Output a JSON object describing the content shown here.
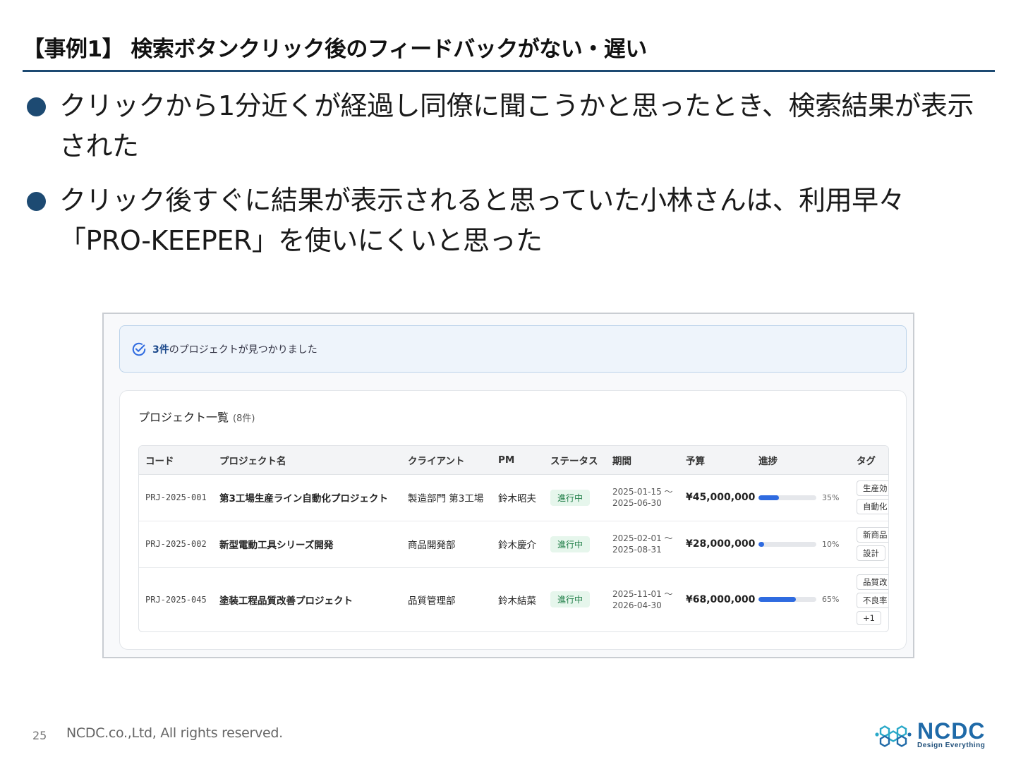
{
  "slide": {
    "title": "【事例1】 検索ボタンクリック後のフィードバックがない・遅い",
    "bullets": [
      "クリックから1分近くが経過し同僚に聞こうかと思ったとき、検索結果が表示された",
      "クリック後すぐに結果が表示されると思っていた小林さんは、利用早々「PRO-KEEPER」を使いにくいと思った"
    ]
  },
  "screenshot": {
    "banner": {
      "count": "3件",
      "text": "のプロジェクトが見つかりました"
    },
    "list": {
      "title": "プロジェクト一覧",
      "count": "(8件)",
      "columns": [
        "コード",
        "プロジェクト名",
        "クライアント",
        "PM",
        "ステータス",
        "期間",
        "予算",
        "進捗",
        "タグ"
      ],
      "rows": [
        {
          "code": "PRJ-2025-001",
          "name": "第3工場生産ライン自動化プロジェクト",
          "client": "製造部門 第3工場",
          "pm": "鈴木昭夫",
          "status": "進行中",
          "period_start": "2025-01-15 〜",
          "period_end": "2025-06-30",
          "budget": "¥45,000,000",
          "progress": 35,
          "progress_label": "35%",
          "tags": [
            "生産効",
            "自動化"
          ]
        },
        {
          "code": "PRJ-2025-002",
          "name": "新型電動工具シリーズ開発",
          "client": "商品開発部",
          "pm": "鈴木慶介",
          "status": "進行中",
          "period_start": "2025-02-01 〜",
          "period_end": "2025-08-31",
          "budget": "¥28,000,000",
          "progress": 10,
          "progress_label": "10%",
          "tags": [
            "新商品",
            "設計"
          ]
        },
        {
          "code": "PRJ-2025-045",
          "name": "塗装工程品質改善プロジェクト",
          "client": "品質管理部",
          "pm": "鈴木結菜",
          "status": "進行中",
          "period_start": "2025-11-01 〜",
          "period_end": "2026-04-30",
          "budget": "¥68,000,000",
          "progress": 65,
          "progress_label": "65%",
          "tags": [
            "品質改",
            "不良率",
            "+1"
          ]
        }
      ]
    }
  },
  "footer": {
    "page_number": "25",
    "copyright": "NCDC.co.,Ltd, All rights reserved.",
    "logo_name": "NCDC",
    "logo_tagline": "Design Everything"
  },
  "colors": {
    "accent": "#1d4a72",
    "progress": "#2f6be0",
    "status_bg": "#e6f6ec",
    "status_text": "#1e7d46"
  }
}
